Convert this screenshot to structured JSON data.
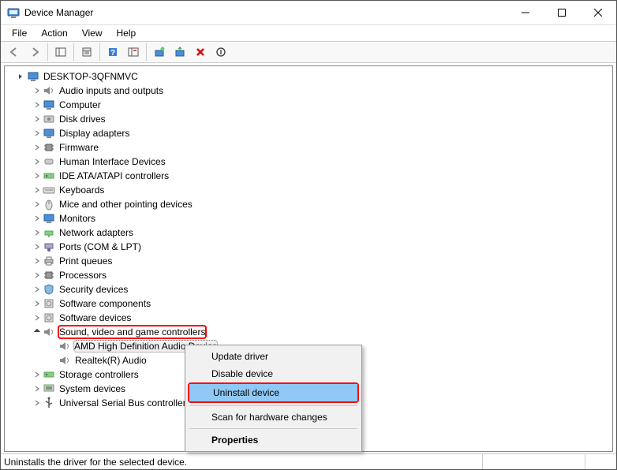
{
  "window": {
    "title": "Device Manager"
  },
  "menubar": {
    "file": "File",
    "action": "Action",
    "view": "View",
    "help": "Help"
  },
  "tree": {
    "root": "DESKTOP-3QFNMVC",
    "items": [
      {
        "label": "Audio inputs and outputs",
        "icon": "speaker"
      },
      {
        "label": "Computer",
        "icon": "monitor"
      },
      {
        "label": "Disk drives",
        "icon": "disk"
      },
      {
        "label": "Display adapters",
        "icon": "monitor"
      },
      {
        "label": "Firmware",
        "icon": "chip"
      },
      {
        "label": "Human Interface Devices",
        "icon": "hid"
      },
      {
        "label": "IDE ATA/ATAPI controllers",
        "icon": "controller"
      },
      {
        "label": "Keyboards",
        "icon": "keyboard"
      },
      {
        "label": "Mice and other pointing devices",
        "icon": "mouse"
      },
      {
        "label": "Monitors",
        "icon": "monitor"
      },
      {
        "label": "Network adapters",
        "icon": "network"
      },
      {
        "label": "Ports (COM & LPT)",
        "icon": "port"
      },
      {
        "label": "Print queues",
        "icon": "printer"
      },
      {
        "label": "Processors",
        "icon": "chip"
      },
      {
        "label": "Security devices",
        "icon": "security"
      },
      {
        "label": "Software components",
        "icon": "software"
      },
      {
        "label": "Software devices",
        "icon": "software"
      }
    ],
    "expanded": {
      "label": "Sound, video and game controllers",
      "children": [
        {
          "label": "AMD High Definition Audio Device"
        },
        {
          "label": "Realtek(R) Audio"
        }
      ]
    },
    "after": [
      {
        "label": "Storage controllers",
        "icon": "controller"
      },
      {
        "label": "System devices",
        "icon": "system"
      },
      {
        "label": "Universal Serial Bus controllers",
        "icon": "usb"
      }
    ]
  },
  "context_menu": {
    "update": "Update driver",
    "disable": "Disable device",
    "uninstall": "Uninstall device",
    "scan": "Scan for hardware changes",
    "props": "Properties"
  },
  "statusbar": {
    "text": "Uninstalls the driver for the selected device."
  }
}
